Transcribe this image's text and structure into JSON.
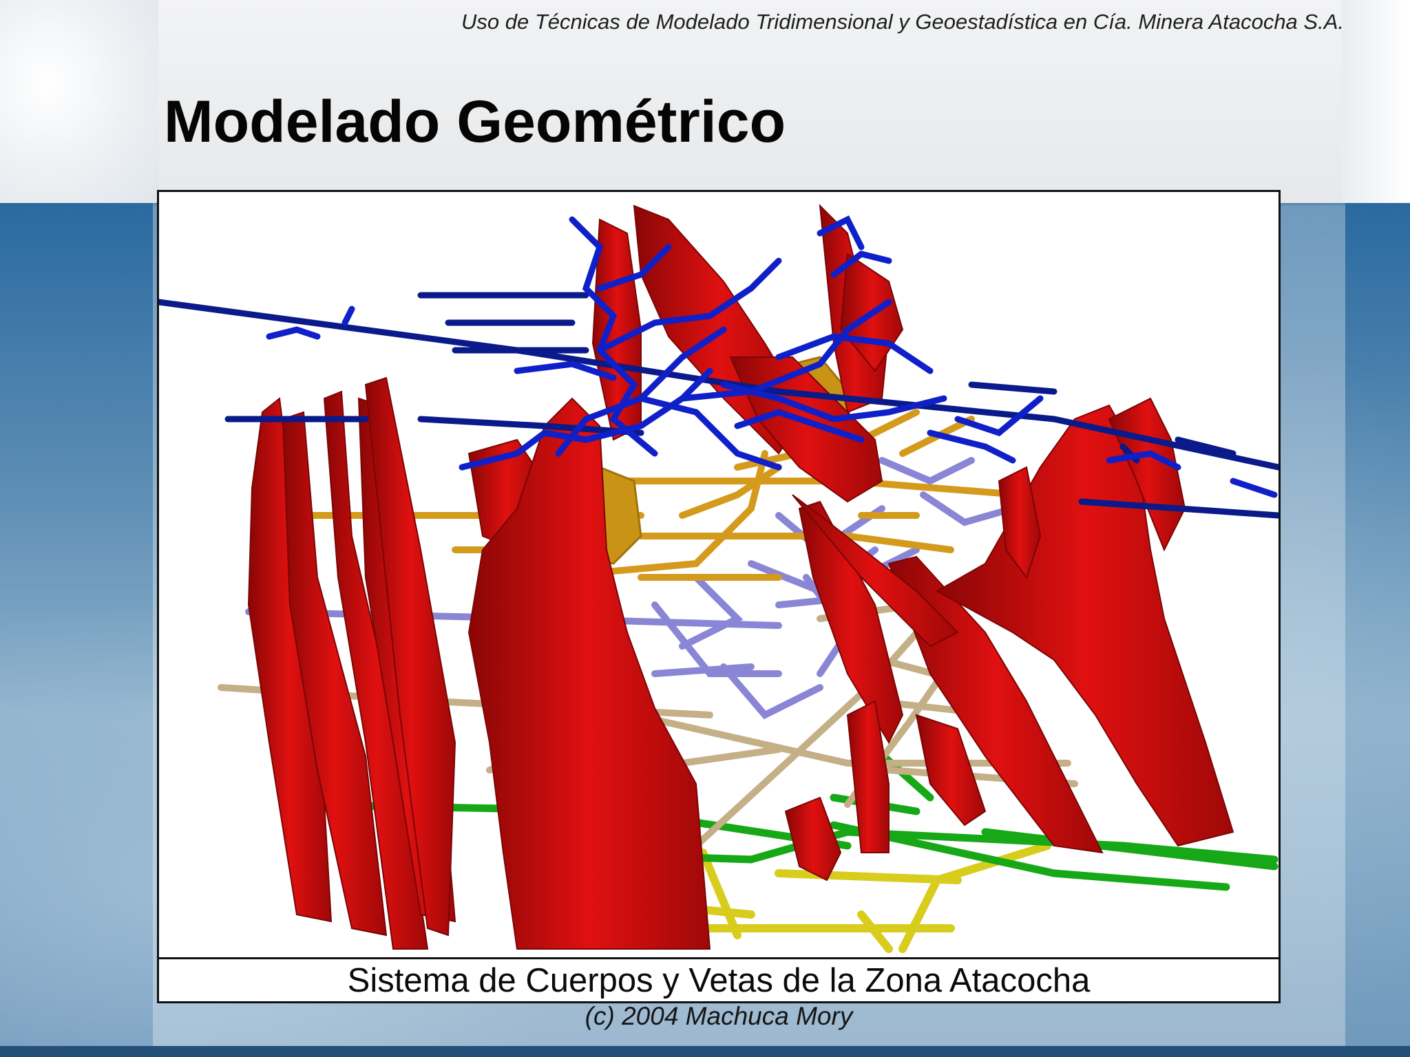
{
  "header": {
    "subtitle": "Uso de Técnicas de Modelado Tridimensional y Geoestadística en Cía. Minera Atacocha S.A."
  },
  "slide": {
    "title": "Modelado Geométrico"
  },
  "figure": {
    "caption": "Sistema de Cuerpos y Vetas de la Zona Atacocha",
    "copyright": "(c) 2004 Machuca Mory"
  },
  "colors": {
    "ore_bodies": "#d40d0d",
    "level_1_workings": "#0f17b5",
    "level_2_workings": "#d4a020",
    "level_3_workings": "#8c88d8",
    "level_4_workings": "#c8b48c",
    "level_5_workings": "#19b019",
    "level_6_workings": "#e0d420",
    "accent_blue": "#1f5f94"
  }
}
